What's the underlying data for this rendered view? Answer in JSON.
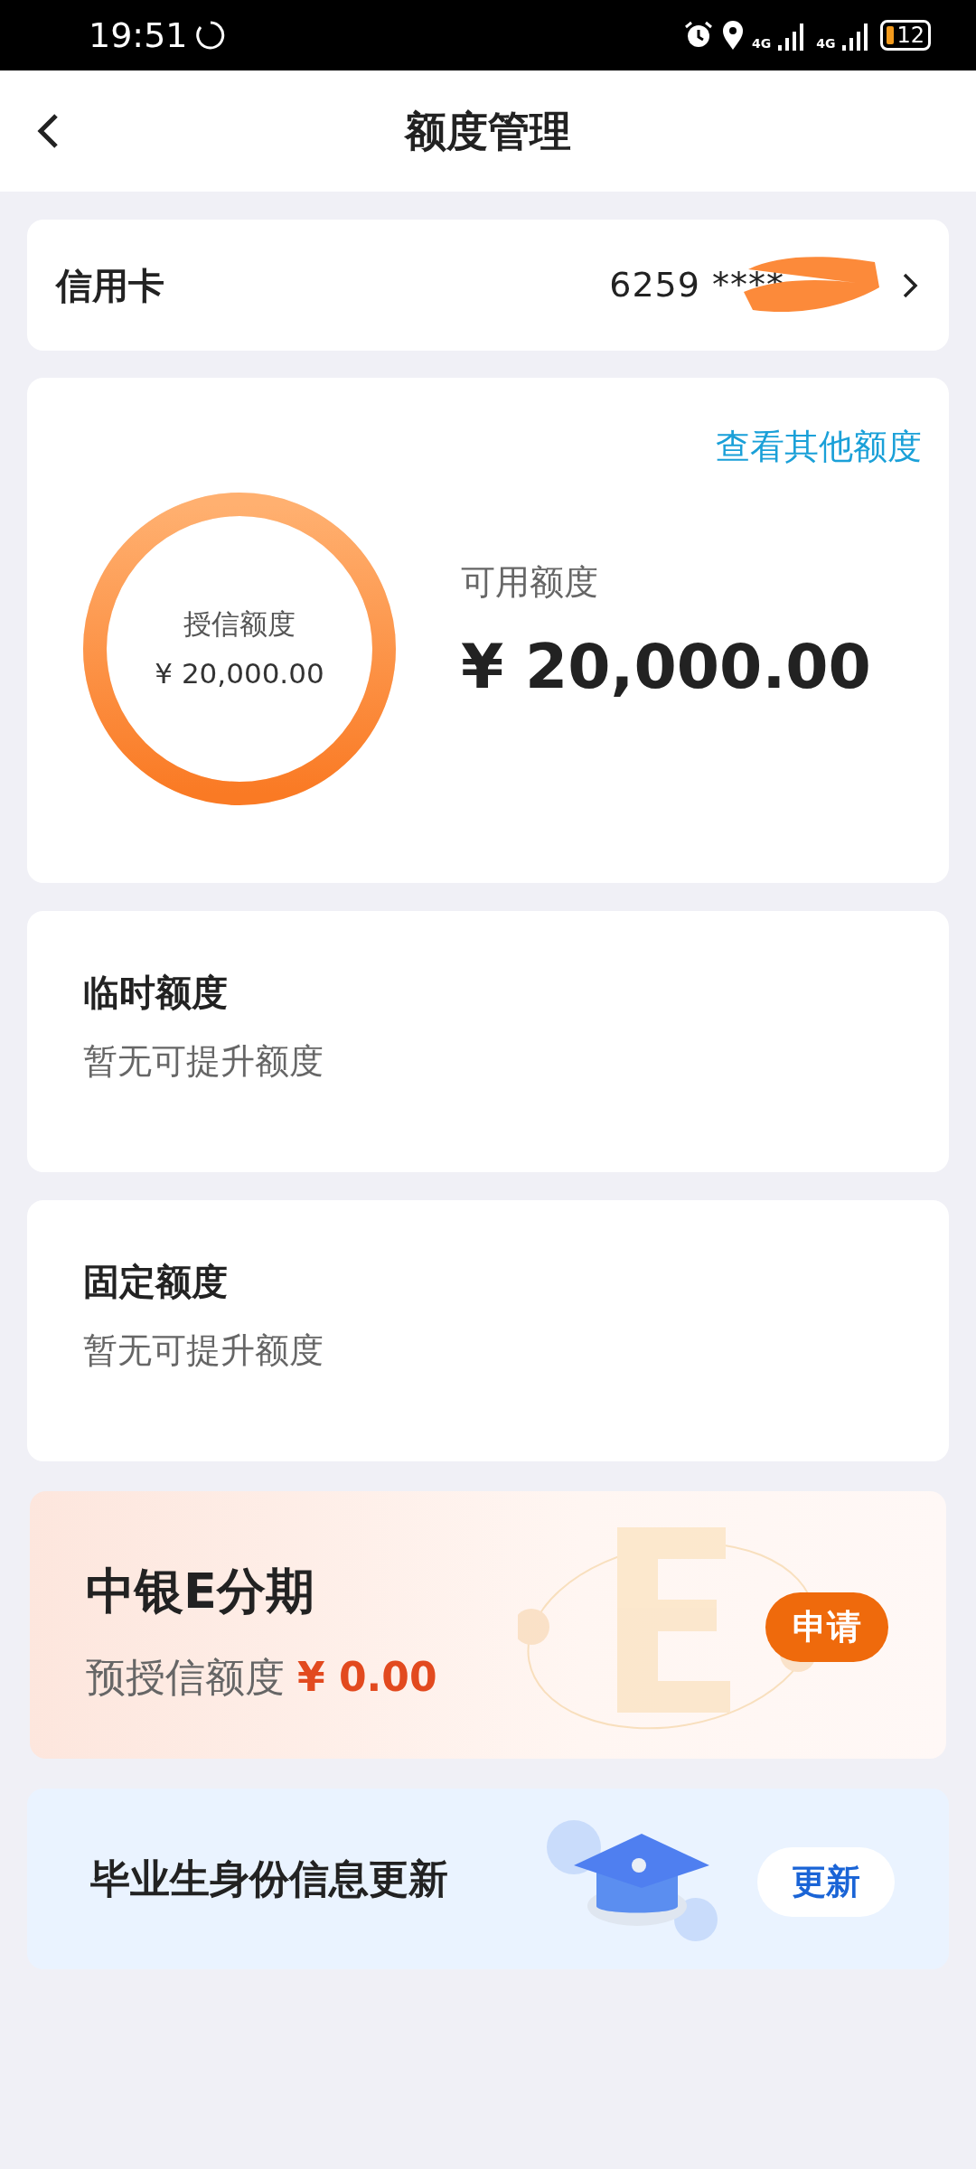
{
  "status_bar": {
    "time": "19:51",
    "network_1": "4G",
    "network_2": "4G",
    "battery": "12"
  },
  "header": {
    "title": "额度管理"
  },
  "card_selector": {
    "label": "信用卡",
    "number": "6259 ****"
  },
  "limit": {
    "link": "查看其他额度",
    "ring_label": "授信额度",
    "ring_amount": "¥ 20,000.00",
    "available_label": "可用额度",
    "available_amount": "¥ 20,000.00",
    "level": 1
  },
  "sections": [
    {
      "title": "临时额度",
      "subtitle": "暂无可提升额度"
    },
    {
      "title": "固定额度",
      "subtitle": "暂无可提升额度"
    }
  ],
  "installment": {
    "title": "中银E分期",
    "label": "预授信额度",
    "amount": "¥ 0.00",
    "button": "申请"
  },
  "graduate": {
    "title": "毕业生身份信息更新",
    "button": "更新"
  }
}
